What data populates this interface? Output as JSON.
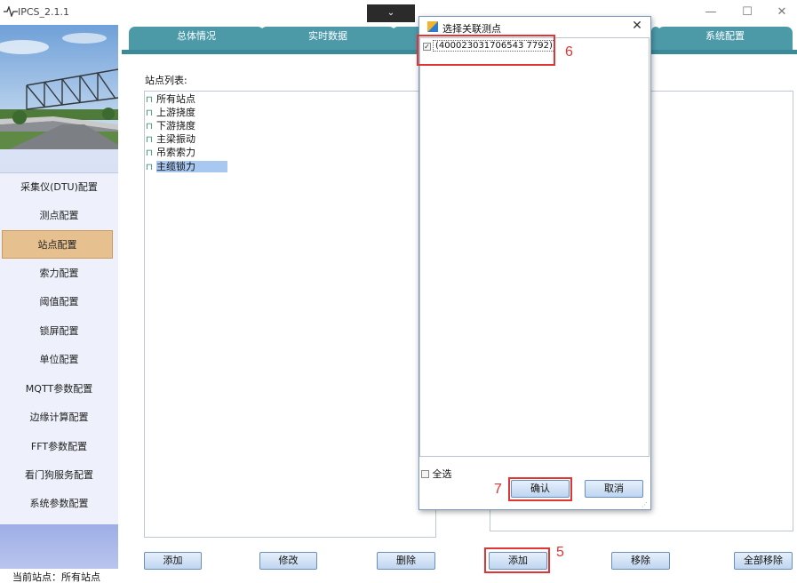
{
  "app": {
    "title": "IPCS_2.1.1",
    "logo_icon": "pulse-icon"
  },
  "window_controls": {
    "dropdown": "⌄",
    "minimize": "—",
    "maximize": "☐",
    "close": "✕"
  },
  "tabs": [
    {
      "label": "总体情况"
    },
    {
      "label": "实时数据"
    },
    {
      "label": "系统配置"
    }
  ],
  "sidebar": {
    "items": [
      {
        "label": "采集仪(DTU)配置"
      },
      {
        "label": "测点配置"
      },
      {
        "label": "站点配置",
        "active": true
      },
      {
        "label": "索力配置"
      },
      {
        "label": "阈值配置"
      },
      {
        "label": "锁屏配置"
      },
      {
        "label": "单位配置"
      },
      {
        "label": "MQTT参数配置"
      },
      {
        "label": "边缘计算配置"
      },
      {
        "label": "FFT参数配置"
      },
      {
        "label": "看门狗服务配置"
      },
      {
        "label": "系统参数配置"
      }
    ]
  },
  "status_bar": {
    "text": "当前站点：所有站点"
  },
  "main": {
    "station_list_label": "站点列表:",
    "stations": [
      {
        "label": "所有站点"
      },
      {
        "label": "上游挠度"
      },
      {
        "label": "下游挠度"
      },
      {
        "label": "主梁振动"
      },
      {
        "label": "吊索索力"
      },
      {
        "label": "主缆锁力",
        "selected": true
      }
    ],
    "buttons": {
      "add": "添加",
      "edit": "修改",
      "delete": "删除",
      "add_right": "添加",
      "remove": "移除",
      "remove_all": "全部移除"
    }
  },
  "dialog": {
    "title": "选择关联测点",
    "close": "✕",
    "points": [
      {
        "label": "(400023031706543 7792)",
        "checked": true
      }
    ],
    "select_all": "全选",
    "confirm": "确认",
    "cancel": "取消"
  },
  "annotations": {
    "step5": "5",
    "step6": "6",
    "step7": "7"
  },
  "colors": {
    "tab": "#4c9aa8",
    "active_menu": "#e7c08f",
    "annotation": "#e03535"
  }
}
